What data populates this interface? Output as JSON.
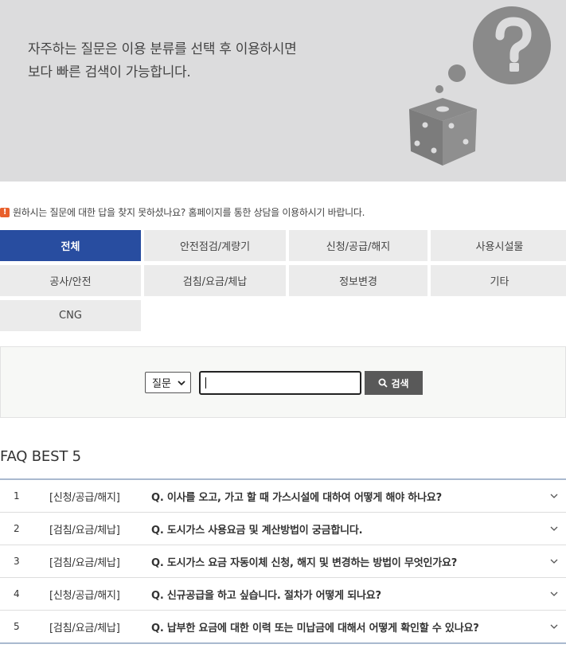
{
  "banner": {
    "line1": "자주하는 질문은 이용 분류를 선택 후 이용하시면",
    "line2": "보다 빠른 검색이 가능합니다."
  },
  "notice": {
    "icon": "!",
    "text": "원하시는 질문에 대한 답을 찾지 못하셨나요? 홈페이지를 통한 상담을 이용하시기 바랍니다."
  },
  "categories": [
    {
      "label": "전체",
      "active": true
    },
    {
      "label": "안전점검/계량기"
    },
    {
      "label": "신청/공급/해지"
    },
    {
      "label": "사용시설물"
    },
    {
      "label": "공사/안전"
    },
    {
      "label": "검침/요금/체납"
    },
    {
      "label": "정보변경"
    },
    {
      "label": "기타"
    },
    {
      "label": "CNG"
    }
  ],
  "search": {
    "select_value": "질문",
    "input_value": "",
    "button_label": "검색"
  },
  "faq": {
    "title": "FAQ BEST 5",
    "rows": [
      {
        "num": "1",
        "category": "[신청/공급/해지]",
        "question": "Q. 이사를 오고, 가고 할 때 가스시설에 대하여 어떻게 해야 하나요?"
      },
      {
        "num": "2",
        "category": "[검침/요금/체납]",
        "question": "Q. 도시가스 사용요금 및 계산방법이 궁금합니다."
      },
      {
        "num": "3",
        "category": "[검침/요금/체납]",
        "question": "Q. 도시가스 요금 자동이체 신청, 해지 및 변경하는 방법이 무엇인가요?"
      },
      {
        "num": "4",
        "category": "[신청/공급/해지]",
        "question": "Q. 신규공급을 하고 싶습니다. 절차가 어떻게 되나요?"
      },
      {
        "num": "5",
        "category": "[검침/요금/체납]",
        "question": "Q. 납부한 요금에 대한 이력 또는 미납금에 대해서 어떻게 확인할 수 있나요?"
      }
    ]
  },
  "colors": {
    "banner_bg": "#dcdcdd",
    "active_tab": "#284da0",
    "tab_bg": "#ebebeb",
    "search_btn": "#595959",
    "notice_icon": "#e8602c"
  },
  "icons": {
    "banner": "question-dice-illustration",
    "notice": "exclamation-icon",
    "search": "search-icon",
    "expand": "chevron-down-icon"
  }
}
